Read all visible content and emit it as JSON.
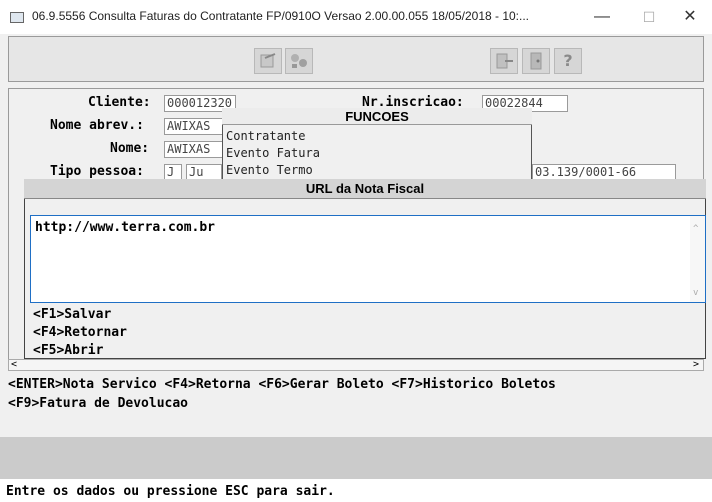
{
  "window": {
    "title": "06.9.5556 Consulta  Faturas do Contratante FP/0910O Versao 2.00.00.055 18/05/2018 - 10:...",
    "minimize": "—",
    "maximize": "☐",
    "close": "✕"
  },
  "toolbar": {
    "icons": [
      "edit-icon",
      "tree-icon",
      "exit-icon",
      "door-icon",
      "help-icon"
    ],
    "help_glyph": "?"
  },
  "form": {
    "cliente_label": "Cliente:",
    "cliente_value": "000012320",
    "nr_inscricao_label": "Nr.inscricao:",
    "nr_inscricao_value": "00022844",
    "nome_abrev_label": "Nome abrev.:",
    "nome_abrev_value": "AWIXAS",
    "nome_label": "Nome:",
    "nome_value": "AWIXAS",
    "tipo_pessoa_label": "Tipo pessoa:",
    "tipo_pessoa_value": "J",
    "tipo_pessoa_extra": "Ju",
    "cnpj_partial": "03.139/0001-66"
  },
  "funcoes": {
    "title": "FUNCOES",
    "items": [
      "Contratante",
      "Evento Fatura",
      "Evento Termo"
    ]
  },
  "modal": {
    "title": "URL da Nota Fiscal",
    "url_value": "http://www.terra.com.br",
    "commands": [
      "<F1>Salvar",
      "<F4>Retornar",
      "<F5>Abrir"
    ]
  },
  "shortcuts": {
    "line1": "<ENTER>Nota Servico <F4>Retorna <F6>Gerar Boleto <F7>Historico Boletos",
    "line2": "<F9>Fatura de Devolucao"
  },
  "status": {
    "message": "Entre os dados ou pressione ESC para sair."
  }
}
